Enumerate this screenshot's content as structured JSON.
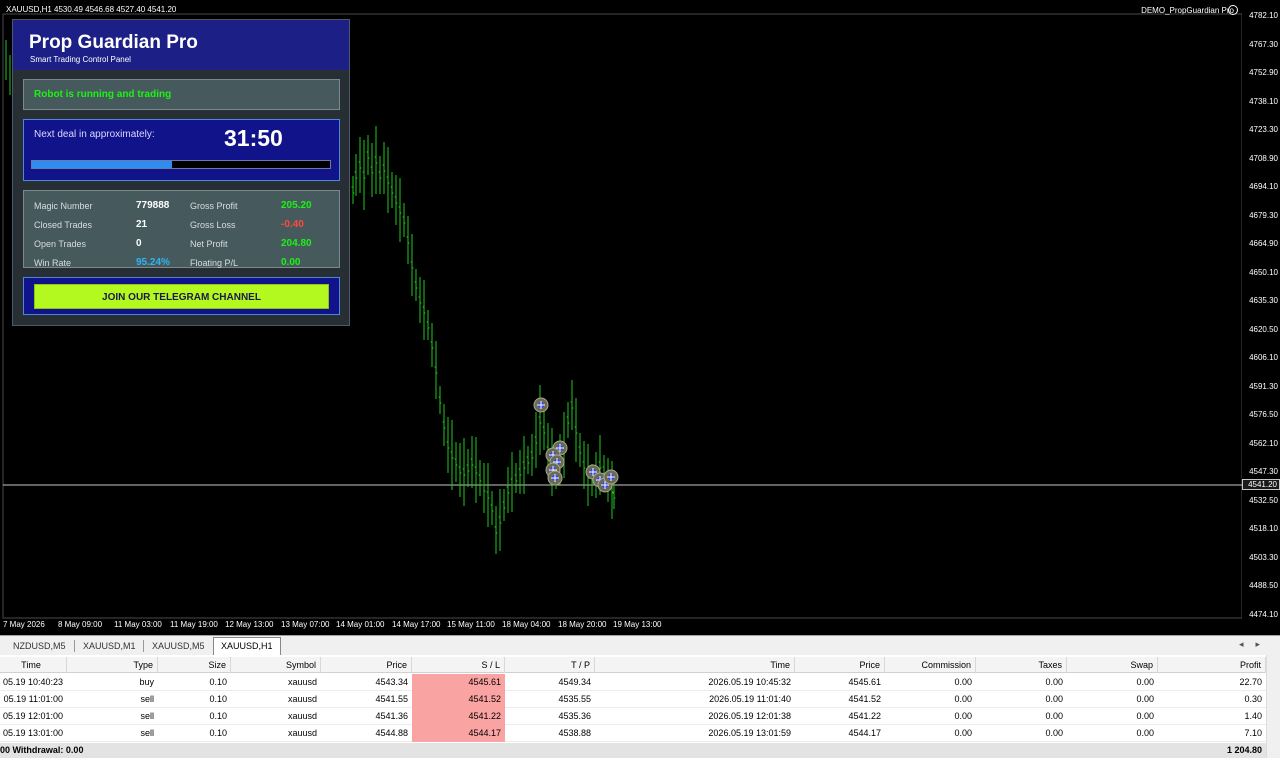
{
  "chart": {
    "header": "XAUUSD,H1  4530.49 4546.68 4527.40 4541.20",
    "ea_name": "DEMO_PropGuardian Pro",
    "current_price": "4541.20",
    "price_axis": [
      "4782.10",
      "4767.30",
      "4752.90",
      "4738.10",
      "4723.30",
      "4708.90",
      "4694.10",
      "4679.30",
      "4664.90",
      "4650.10",
      "4635.30",
      "4620.50",
      "4606.10",
      "4591.30",
      "4576.50",
      "4562.10",
      "4547.30",
      "4532.50",
      "4518.10",
      "4503.30",
      "4488.50",
      "4474.10"
    ],
    "time_axis": [
      "7 May 2026",
      "8 May 09:00",
      "11 May 03:00",
      "11 May 19:00",
      "12 May 13:00",
      "13 May 07:00",
      "14 May 01:00",
      "14 May 17:00",
      "15 May 11:00",
      "18 May 04:00",
      "18 May 20:00",
      "19 May 13:00"
    ],
    "colors": {
      "candle": "#22c81e",
      "background": "#000000",
      "price_line": "#c8c8c8"
    }
  },
  "panel": {
    "title": "Prop Guardian Pro",
    "subtitle": "Smart Trading Control Panel",
    "status": "Robot is running and trading",
    "timer_label": "Next deal in approximately:",
    "timer_value": "31:50",
    "progress": 0.47,
    "stats": {
      "magic_label": "Magic Number",
      "magic_value": "779888",
      "closed_label": "Closed Trades",
      "closed_value": "21",
      "open_label": "Open Trades",
      "open_value": "0",
      "winrate_label": "Win Rate",
      "winrate_value": "95.24%",
      "gross_profit_label": "Gross Profit",
      "gross_profit_value": "205.20",
      "gross_loss_label": "Gross Loss",
      "gross_loss_value": "-0.40",
      "net_profit_label": "Net Profit",
      "net_profit_value": "204.80",
      "floating_label": "Floating P/L",
      "floating_value": "0.00"
    },
    "telegram_label": "JOIN OUR TELEGRAM CHANNEL"
  },
  "tabs": [
    "NZDUSD,M5",
    "XAUUSD,M1",
    "XAUUSD,M5",
    "XAUUSD,H1"
  ],
  "table": {
    "headers": [
      "Time",
      "Type",
      "Size",
      "Symbol",
      "Price",
      "S / L",
      "T / P",
      "Time",
      "Price",
      "Commission",
      "Taxes",
      "Swap",
      "Profit"
    ],
    "rows": [
      [
        "05.19 10:40:23",
        "buy",
        "0.10",
        "xauusd",
        "4543.34",
        "4545.61",
        "4549.34",
        "2026.05.19 10:45:32",
        "4545.61",
        "0.00",
        "0.00",
        "0.00",
        "22.70"
      ],
      [
        "05.19 11:01:00",
        "sell",
        "0.10",
        "xauusd",
        "4541.55",
        "4541.52",
        "4535.55",
        "2026.05.19 11:01:40",
        "4541.52",
        "0.00",
        "0.00",
        "0.00",
        "0.30"
      ],
      [
        "05.19 12:01:00",
        "sell",
        "0.10",
        "xauusd",
        "4541.36",
        "4541.22",
        "4535.36",
        "2026.05.19 12:01:38",
        "4541.22",
        "0.00",
        "0.00",
        "0.00",
        "1.40"
      ],
      [
        "05.19 13:01:00",
        "sell",
        "0.10",
        "xauusd",
        "4544.88",
        "4544.17",
        "4538.88",
        "2026.05.19 13:01:59",
        "4544.17",
        "0.00",
        "0.00",
        "0.00",
        "7.10"
      ]
    ],
    "footer_left": "00  Withdrawal: 0.00",
    "footer_right": "1 204.80"
  }
}
